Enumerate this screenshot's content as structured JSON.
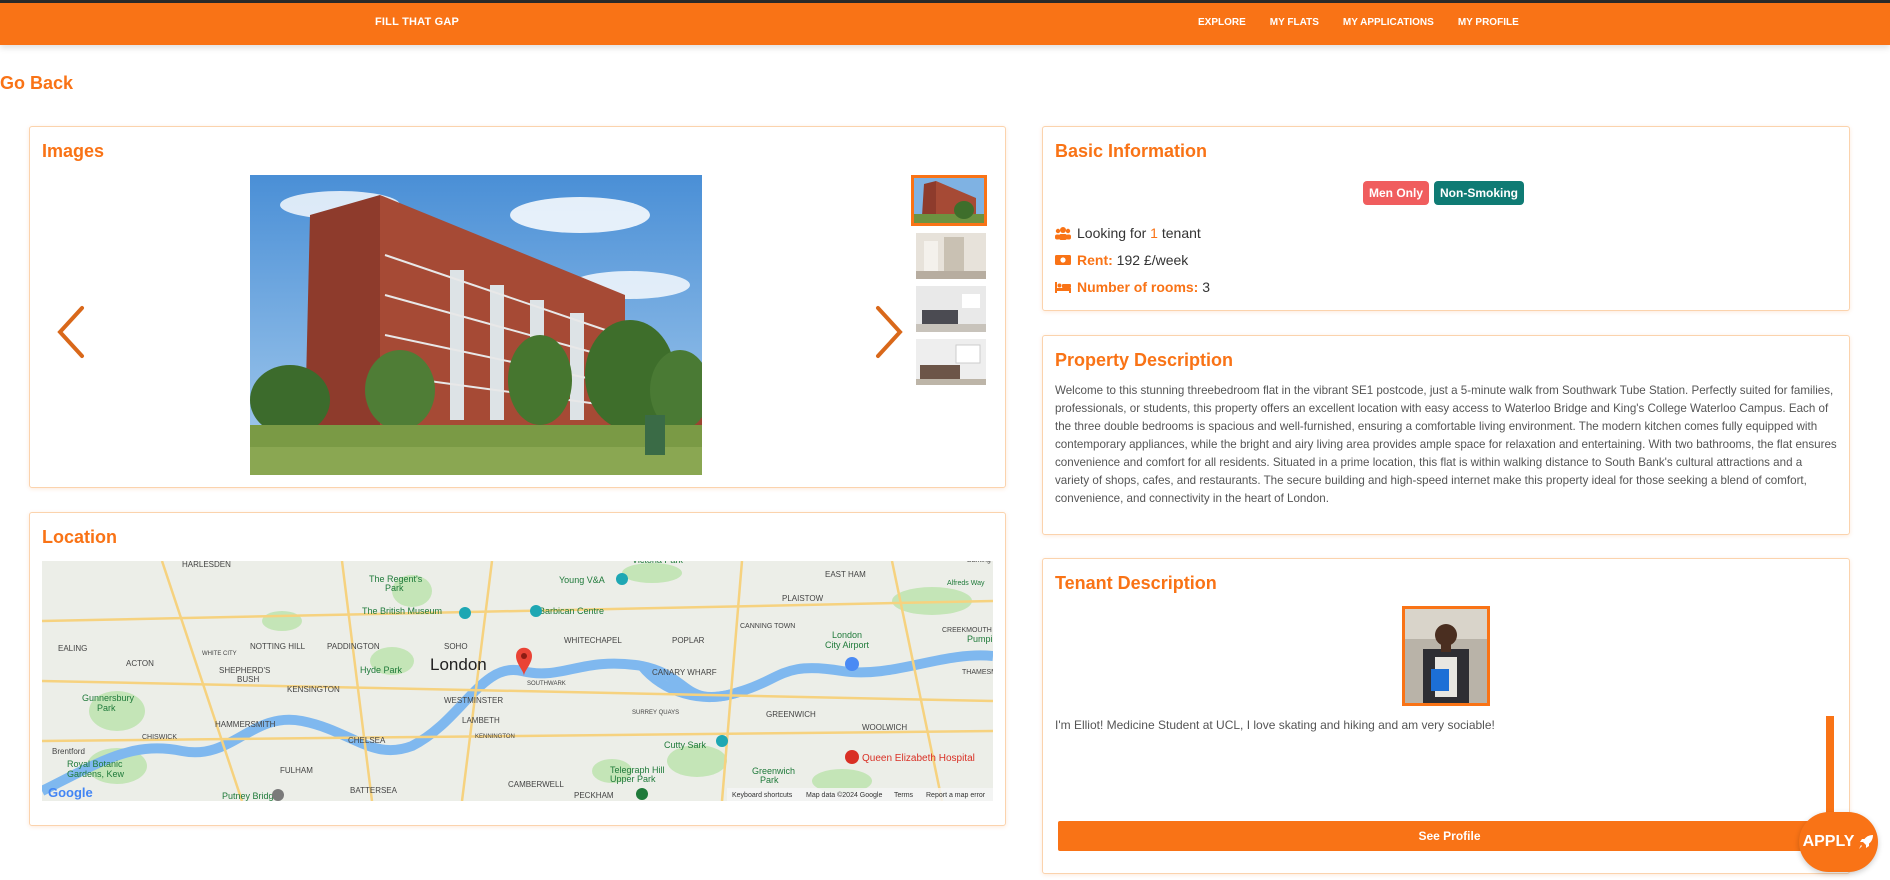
{
  "nav": {
    "brand": "FILL THAT GAP",
    "links": [
      "EXPLORE",
      "MY FLATS",
      "MY APPLICATIONS",
      "MY PROFILE"
    ]
  },
  "go_back": "Go Back",
  "images": {
    "title": "Images",
    "thumb_count": 4,
    "active_index": 0
  },
  "location": {
    "title": "Location",
    "map": {
      "city": "London",
      "labels": [
        "HARLESDEN",
        "NOTTING HILL",
        "PADDINGTON",
        "SOHO",
        "WHITECHAPEL",
        "POPLAR",
        "EAST HAM",
        "PLAISTOW",
        "EALING",
        "ACTON",
        "WHITE CITY",
        "SHEPHERD'S BUSH",
        "KENSINGTON",
        "WESTMINSTER",
        "LAMBETH",
        "SOUTHWARK",
        "CANARY WHARF",
        "CANNING TOWN",
        "CREEKMOUTH",
        "HAMMERSMITH",
        "CHISWICK",
        "CHELSEA",
        "GREENWICH",
        "WOOLWICH",
        "KENNINGTON",
        "SURREY QUAYS",
        "Brentford",
        "FULHAM",
        "BATTERSEA",
        "CAMBERWELL",
        "PECKHAM",
        "THAMESM",
        "Gunnersbury Park",
        "Hyde Park",
        "The Regent's Park",
        "The British Museum",
        "Barbican Centre",
        "Young V&A",
        "Victoria Park",
        "London City Airport",
        "Royal Botanic Gardens, Kew",
        "Cutty Sark",
        "Greenwich Park",
        "Queen Elizabeth Hospital",
        "Telegraph Hill Upper Park",
        "Putney Bridge",
        "Barking",
        "Alfreds Way",
        "Pumpin"
      ],
      "footer": [
        "Keyboard shortcuts",
        "Map data ©2024 Google",
        "Terms",
        "Report a map error"
      ],
      "google": "Google"
    }
  },
  "basic": {
    "title": "Basic Information",
    "badges": [
      {
        "label": "Men Only",
        "color": "#f05d5e"
      },
      {
        "label": "Non-Smoking",
        "color": "#0f7b74"
      }
    ],
    "looking_prefix": "Looking for",
    "looking_count": "1",
    "looking_suffix": "tenant",
    "rent_label": "Rent:",
    "rent_value": "192 £/week",
    "rooms_label": "Number of rooms:",
    "rooms_value": "3"
  },
  "description": {
    "title": "Property Description",
    "text": "Welcome to this stunning threebedroom flat in the vibrant SE1 postcode, just a 5-minute walk from Southwark Tube Station. Perfectly suited for families, professionals, or students, this property offers an excellent location with easy access to Waterloo Bridge and King's College Waterloo Campus. Each of the three double bedrooms is spacious and well-furnished, ensuring a comfortable living environment. The modern kitchen comes fully equipped with contemporary appliances, while the bright and airy living area provides ample space for relaxation and entertaining. With two bathrooms, the flat ensures convenience and comfort for all residents. Situated in a prime location, this flat is within walking distance to South Bank's cultural attractions and a variety of shops, cafes, and restaurants. The secure building and high-speed internet make this property ideal for those seeking a blend of comfort, convenience, and connectivity in the heart of London."
  },
  "tenant": {
    "title": "Tenant Description",
    "text": "I'm Elliot! Medicine Student at UCL, I love skating and hiking and am very sociable!",
    "button": "See Profile"
  },
  "apply": {
    "label": "APPLY",
    "icon": "rocket-icon"
  },
  "colors": {
    "accent": "#f97316",
    "men_only": "#f05d5e",
    "non_smoking": "#0f7b74"
  }
}
